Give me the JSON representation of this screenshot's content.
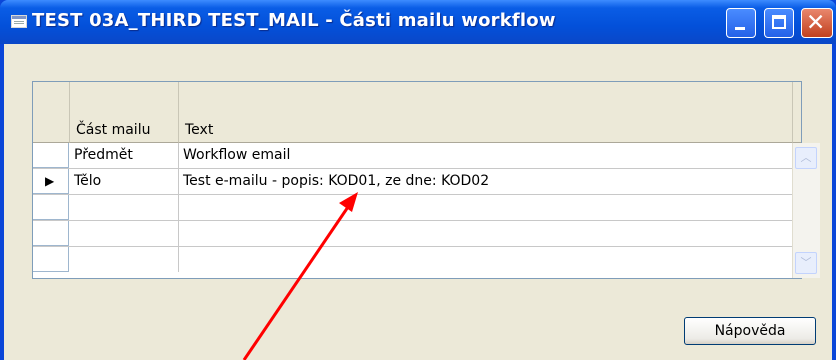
{
  "window": {
    "title": "TEST 03A_THIRD TEST_MAIL - Části mailu workflow",
    "icon": "form-icon",
    "controls": [
      "minimize-icon",
      "maximize-icon",
      "close-icon"
    ]
  },
  "grid": {
    "columns": [
      "Část mailu",
      "Text"
    ],
    "rows": [
      {
        "part": "Předmět",
        "text": "Workflow email",
        "current": false
      },
      {
        "part": "Tělo",
        "text": "Test e-mailu - popis: KOD01, ze dne: KOD02",
        "current": true
      },
      {
        "part": "",
        "text": "",
        "current": false
      },
      {
        "part": "",
        "text": "",
        "current": false
      },
      {
        "part": "",
        "text": "",
        "current": false
      }
    ],
    "current_row_marker": "▶"
  },
  "buttons": {
    "help_label": "Nápověda"
  },
  "annotation": {
    "arrow_color": "#ff0000"
  },
  "colors": {
    "titlebar": "#0a5de6",
    "client_background": "#ece9d8",
    "close_button": "#d9603f"
  }
}
